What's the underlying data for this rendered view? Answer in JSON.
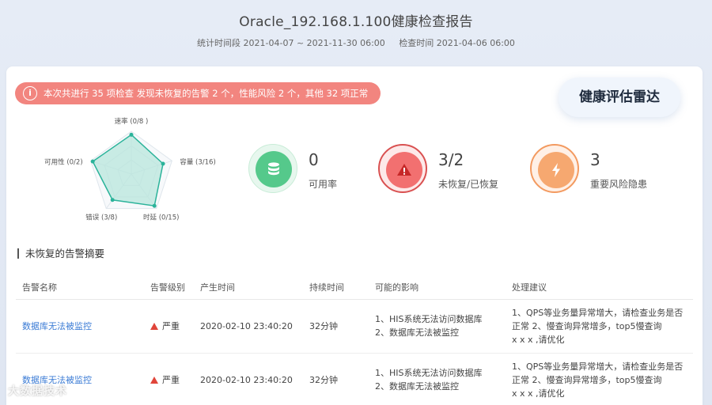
{
  "header": {
    "title": "Oracle_192.168.1.100健康检查报告",
    "period": "统计时间段 2021-04-07 ~ 2021-11-30 06:00",
    "check_time": "检查时间 2021-04-06 06:00"
  },
  "banner": {
    "icon": "info-icon",
    "text": "本次共进行 35 项检查 发现未恢复的告警 2 个，性能风险 2 个，其他 32 项正常"
  },
  "radar_button": {
    "label": "健康评估雷达"
  },
  "radar": {
    "axes": [
      {
        "label": "速率 (0/8 )",
        "value": 0.92
      },
      {
        "label": "容量 (3/16)",
        "value": 0.78
      },
      {
        "label": "时延 (0/15)",
        "value": 0.92
      },
      {
        "label": "错误 (3/8)",
        "value": 0.75
      },
      {
        "label": "可用性 (0/2)",
        "value": 0.95
      }
    ],
    "colors": {
      "fill": "#b8e6dc",
      "stroke": "#2bb39a",
      "grid": "#dfe6ec"
    }
  },
  "stats": [
    {
      "value": "0",
      "label": "可用率",
      "icon": "database-icon",
      "color": "#55c98b"
    },
    {
      "value": "3/2",
      "label": "未恢复/已恢复",
      "icon": "warning-icon",
      "color": "#f27070"
    },
    {
      "value": "3",
      "label": "重要风险隐患",
      "icon": "lightning-icon",
      "color": "#f6a870"
    }
  ],
  "section": {
    "title": "未恢复的告警摘要"
  },
  "table": {
    "headers": [
      "告警名称",
      "告警级别",
      "产生时间",
      "持续时间",
      "可能的影响",
      "处理建议"
    ],
    "rows": [
      {
        "name": "数据库无法被监控",
        "level": "严重",
        "time": "2020-02-10 23:40:20",
        "duration": "32分钟",
        "impact_1": "1、HIS系统无法访问数据库",
        "impact_2": "2、数据库无法被监控",
        "advice_1": "1、QPS等业务量异常增大，请检查业务是否",
        "advice_2": "正常   2、慢查询异常增多，top5慢查询",
        "advice_3": "x x x ,请优化"
      },
      {
        "name": "数据库无法被监控",
        "level": "严重",
        "time": "2020-02-10 23:40:20",
        "duration": "32分钟",
        "impact_1": "1、HIS系统无法访问数据库",
        "impact_2": "2、数据库无法被监控",
        "advice_1": "1、QPS等业务量异常增大，请检查业务是否",
        "advice_2": "正常   2、慢查询异常增多，top5慢查询",
        "advice_3": "x x x ,请优化"
      }
    ]
  },
  "watermark": {
    "text": "大数据技术"
  }
}
